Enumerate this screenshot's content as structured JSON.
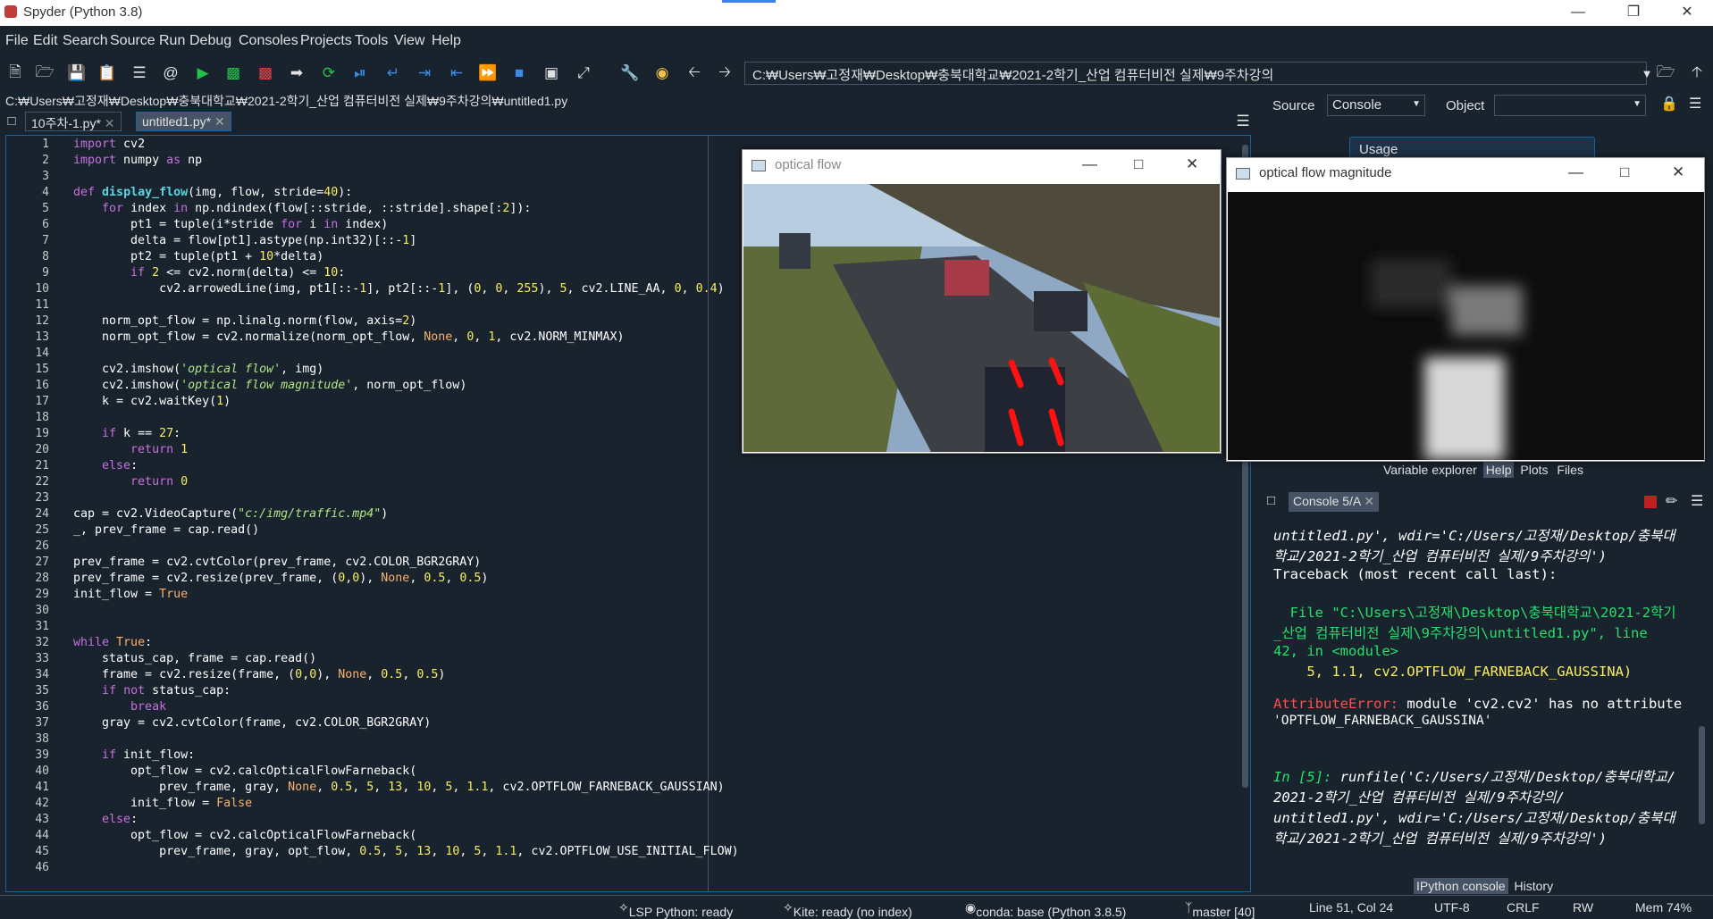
{
  "window": {
    "title": "Spyder (Python 3.8)"
  },
  "menu": [
    "File",
    "Edit",
    "Search",
    "Source",
    "Run",
    "Debug",
    "Consoles",
    "Projects",
    "Tools",
    "View",
    "Help"
  ],
  "toolbar": {
    "path": "C:₩Users₩고정재₩Desktop₩충북대학교₩2021-2학기_산업 컴퓨터비전 실제₩9주차강의"
  },
  "editor": {
    "file_path": "C:₩Users₩고정재₩Desktop₩충북대학교₩2021-2학기_산업 컴퓨터비전 실제₩9주차강의₩untitled1.py",
    "tabs": [
      {
        "label": "10주차-1.py*"
      },
      {
        "label": "untitled1.py*"
      }
    ],
    "line_numbers": [
      "1",
      "2",
      "3",
      "4",
      "5",
      "6",
      "7",
      "8",
      "9",
      "10",
      "11",
      "12",
      "13",
      "14",
      "15",
      "16",
      "17",
      "18",
      "19",
      "20",
      "21",
      "22",
      "23",
      "24",
      "25",
      "26",
      "27",
      "28",
      "29",
      "30",
      "31",
      "32",
      "33",
      "34",
      "35",
      "36",
      "37",
      "38",
      "39",
      "40",
      "41",
      "42",
      "43",
      "44",
      "45",
      "46"
    ],
    "code": [
      "import cv2",
      "import numpy as np",
      "",
      "def display_flow(img, flow, stride=40):",
      "    for index in np.ndindex(flow[::stride, ::stride].shape[:2]):",
      "        pt1 = tuple(i*stride for i in index)",
      "        delta = flow[pt1].astype(np.int32)[::-1]",
      "        pt2 = tuple(pt1 + 10*delta)",
      "        if 2 <= cv2.norm(delta) <= 10:",
      "            cv2.arrowedLine(img, pt1[::-1], pt2[::-1], (0, 0, 255), 5, cv2.LINE_AA, 0, 0.4)",
      "",
      "    norm_opt_flow = np.linalg.norm(flow, axis=2)",
      "    norm_opt_flow = cv2.normalize(norm_opt_flow, None, 0, 1, cv2.NORM_MINMAX)",
      "",
      "    cv2.imshow('optical flow', img)",
      "    cv2.imshow('optical flow magnitude', norm_opt_flow)",
      "    k = cv2.waitKey(1)",
      "",
      "    if k == 27:",
      "        return 1",
      "    else:",
      "        return 0",
      "",
      "cap = cv2.VideoCapture(\"c:/img/traffic.mp4\")",
      "_, prev_frame = cap.read()",
      "",
      "prev_frame = cv2.cvtColor(prev_frame, cv2.COLOR_BGR2GRAY)",
      "prev_frame = cv2.resize(prev_frame, (0,0), None, 0.5, 0.5)",
      "init_flow = True",
      "",
      "",
      "while True:",
      "    status_cap, frame = cap.read()",
      "    frame = cv2.resize(frame, (0,0), None, 0.5, 0.5)",
      "    if not status_cap:",
      "        break",
      "    gray = cv2.cvtColor(frame, cv2.COLOR_BGR2GRAY)",
      "",
      "    if init_flow:",
      "        opt_flow = cv2.calcOpticalFlowFarneback(",
      "            prev_frame, gray, None, 0.5, 5, 13, 10, 5, 1.1, cv2.OPTFLOW_FARNEBACK_GAUSSIAN)",
      "        init_flow = False",
      "    else:",
      "        opt_flow = cv2.calcOpticalFlowFarneback(",
      "            prev_frame, gray, opt_flow, 0.5, 5, 13, 10, 5, 1.1, cv2.OPTFLOW_USE_INITIAL_FLOW)",
      ""
    ]
  },
  "help_pane": {
    "source_label": "Source",
    "source_value": "Console",
    "object_label": "Object",
    "usage_label": "Usage",
    "tabs": [
      "Variable explorer",
      "Help",
      "Plots",
      "Files"
    ],
    "active_tab": "Help"
  },
  "console": {
    "tab_label": "Console 5/A",
    "bottom_tabs": [
      "IPython console",
      "History"
    ],
    "lines": [
      "untitled1.py', wdir='C:/Users/고정재/Desktop/충북대",
      "학교/2021-2학기_산업 컴퓨터비전 실제/9주차강의')",
      "Traceback (most recent call last):",
      "  File \"C:\\Users\\고정재\\Desktop\\충북대학교\\2021-2학기",
      "_산업 컴퓨터비전 실제\\9주차강의\\untitled1.py\", line",
      "42, in <module>",
      "    5, 1.1, cv2.OPTFLOW_FARNEBACK_GAUSSINA)",
      "AttributeError: module 'cv2.cv2' has no attribute",
      "'OPTFLOW_FARNEBACK_GAUSSINA'",
      "In [5]: runfile('C:/Users/고정재/Desktop/충북대학교/",
      "2021-2학기_산업 컴퓨터비전 실제/9주차강의/",
      "untitled1.py', wdir='C:/Users/고정재/Desktop/충북대",
      "학교/2021-2학기_산업 컴퓨터비전 실제/9주차강의')"
    ]
  },
  "windows": {
    "optical_flow": {
      "title": "optical flow"
    },
    "magnitude": {
      "title": "optical flow magnitude"
    }
  },
  "statusbar": {
    "lsp": "LSP Python: ready",
    "kite": "Kite: ready (no index)",
    "conda": "conda: base (Python 3.8.5)",
    "git": "master [40]",
    "position": "Line 51, Col 24",
    "encoding": "UTF-8",
    "eol": "CRLF",
    "rw": "RW",
    "mem": "Mem 74%"
  }
}
